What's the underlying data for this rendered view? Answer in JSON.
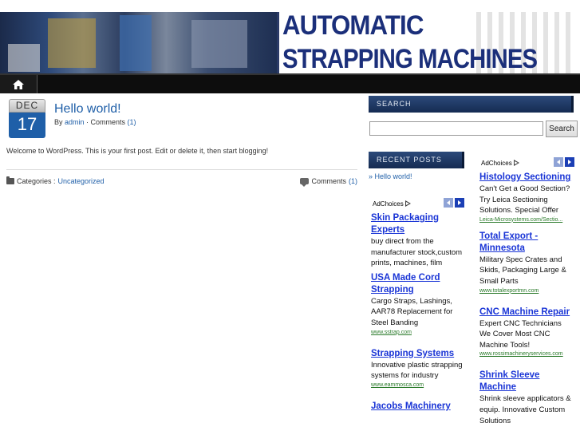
{
  "header": {
    "title_line1": "AUTOMATIC",
    "title_line2": "STRAPPING MACHINES"
  },
  "nav": {
    "home_icon": "home-icon"
  },
  "post": {
    "date_month": "DEC",
    "date_day": "17",
    "title": "Hello world!",
    "meta_by": "By ",
    "author": "admin",
    "meta_sep": " · Comments ",
    "comments_count": "(1)",
    "body": "Welcome to WordPress. This is your first post. Edit or delete it, then start blogging!",
    "categories_label": "Categories : ",
    "category": "Uncategorized",
    "comments_label": "Comments ",
    "comments_link": "(1)"
  },
  "sidebar": {
    "search_title": "SEARCH",
    "search_button": "Search",
    "search_value": "",
    "recent_title": "RECENT POSTS",
    "recent_posts": [
      "» Hello world!"
    ]
  },
  "ads": {
    "adchoices_label": "AdChoices",
    "col1": [
      {
        "title": "Skin Packaging Experts",
        "desc": "buy direct from the manufacturer stock,custom prints, machines, film",
        "url": ""
      },
      {
        "title": "USA Made Cord Strapping",
        "desc": "Cargo Straps, Lashings, AAR78 Replacement for Steel Banding",
        "url": "www.sstrap.com"
      },
      {
        "title": "Strapping Systems",
        "desc": "Innovative plastic strapping systems for industry",
        "url": "www.eammosca.com"
      },
      {
        "title": "Jacobs Machinery",
        "desc": "",
        "url": ""
      }
    ],
    "col2": [
      {
        "title": "Histology Sectioning",
        "desc": "Can't Get a Good Section? Try Leica Sectioning Solutions. Special Offer",
        "url": "Leica-Microsystems.com/Sectio..."
      },
      {
        "title": "Total Export - Minnesota",
        "desc": "Military Spec Crates and Skids, Packaging Large & Small Parts",
        "url": "www.totalexportmn.com"
      },
      {
        "title": "CNC Machine Repair",
        "desc": "Expert CNC Technicians We Cover Most CNC Machine Tools!",
        "url": "www.rossimachineryservices.com"
      },
      {
        "title": "Shrink Sleeve Machine",
        "desc": "Shrink sleeve applicators & equip. Innovative Custom Solutions",
        "url": ""
      }
    ]
  },
  "colors": {
    "accent_blue": "#1f5fa8",
    "ad_link": "#1a35d6",
    "ad_url": "#2a7a2a",
    "nav_bg": "#0d0d0d",
    "widget_bg": "#152b52",
    "header_title": "#1b2f7a"
  }
}
